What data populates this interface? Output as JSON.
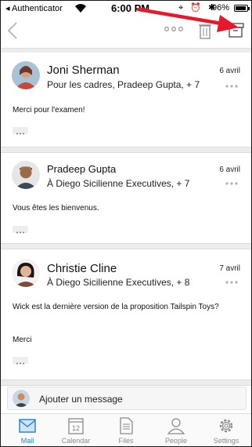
{
  "status_bar": {
    "back_app": "◂ Authenticator",
    "time": "6:00 PM",
    "status_icons": "⌖ ⏰ ✱",
    "battery_pct": "96%",
    "battery_level": 0.96
  },
  "toolbar": {
    "back_icon": "chevron-left-icon",
    "more_icon": "ellipsis-icon",
    "trash_icon": "trash-icon",
    "archive_icon": "archive-icon"
  },
  "messages": [
    {
      "sender": "Joni Sherman",
      "recipients": "Pour les cadres, Pradeep Gupta, + 7",
      "date": "6 avril",
      "body": "Merci pour l'examen!",
      "body2": ""
    },
    {
      "sender": "Pradeep Gupta",
      "recipients": "À Diego Sicilienne Executives, + 7",
      "date": "6 avril",
      "body": "Vous êtes les bienvenus.",
      "body2": ""
    },
    {
      "sender": "Christie Cline",
      "recipients": "À Diego Sicilienne Executives, + 8",
      "date": "7 avril",
      "body": "Wick est la dernière version de la proposition Tailspin Toys?",
      "body2": "Merci"
    }
  ],
  "reply": {
    "label": "Ajouter un message"
  },
  "tabs": [
    {
      "label": "Mail",
      "icon": "mail-icon",
      "active": true
    },
    {
      "label": "Calendar",
      "icon": "calendar-icon",
      "day": "12",
      "active": false
    },
    {
      "label": "Files",
      "icon": "files-icon",
      "active": false
    },
    {
      "label": "People",
      "icon": "people-icon",
      "active": false
    },
    {
      "label": "Settings",
      "icon": "settings-icon",
      "active": false
    }
  ],
  "colors": {
    "accent": "#1d7fd1",
    "arrow": "#e8182c",
    "inactive": "#8a8a8a"
  }
}
